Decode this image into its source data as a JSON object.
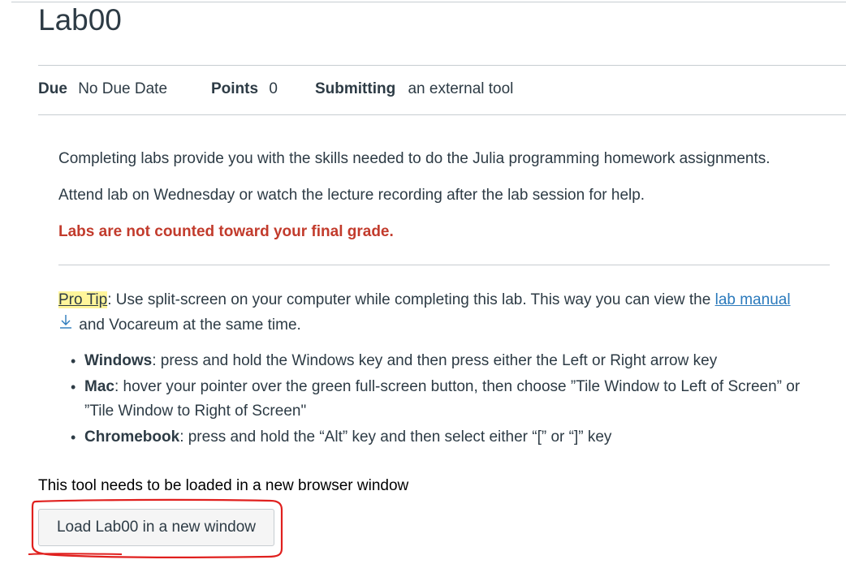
{
  "assignment": {
    "title": "Lab00",
    "due_label": "Due",
    "due_value": "No Due Date",
    "points_label": "Points",
    "points_value": "0",
    "submitting_label": "Submitting",
    "submitting_value": "an external tool"
  },
  "description": {
    "p1": "Completing labs provide you with the skills needed to do the Julia programming homework assignments.",
    "p2": "Attend lab on Wednesday or watch the lecture recording after the lab session for help.",
    "p3": "Labs are not counted toward your final grade.",
    "tip_label": "Pro Tip",
    "tip_colon": ":",
    "tip_text": " Use split-screen on your computer while completing this lab. This way you can view the ",
    "tip_link": "lab manual",
    "tip_end": " and Vocareum at the same time.",
    "list": [
      {
        "bold": "Windows",
        "text": ": press and hold the Windows key and then press either the Left or Right arrow key"
      },
      {
        "bold": "Mac",
        "text": ": hover your pointer over the green full-screen button, then choose ”Tile Window to Left of Screen” or ”Tile Window to Right of Screen\""
      },
      {
        "bold": "Chromebook",
        "text": ": press and hold the “Alt” key and then select either “[” or “]” key"
      }
    ]
  },
  "external_tool": {
    "note": "This tool needs to be loaded in a new browser window",
    "button_label": "Load Lab00 in a new window"
  },
  "colors": {
    "text": "#2d3b45",
    "warning_red": "#c23b2c",
    "link_blue": "#2b7abc",
    "highlight_yellow": "#fff59b",
    "annotation_red": "#e0201e"
  }
}
